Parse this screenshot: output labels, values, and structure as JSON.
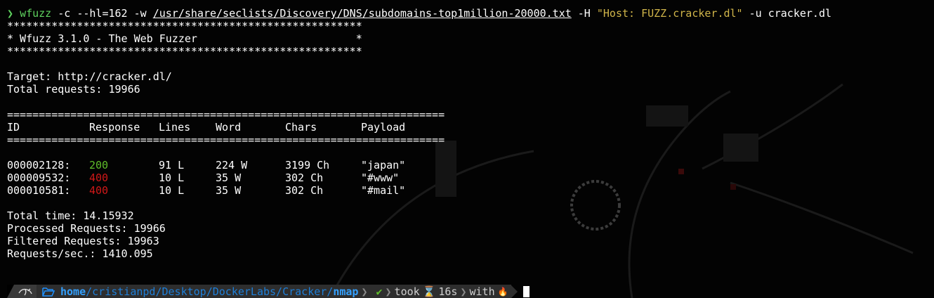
{
  "command": {
    "prompt_symbol": "❯",
    "program": "wfuzz",
    "args_before_path": " -c --hl=162 -w ",
    "wordlist_path": "/usr/share/seclists/Discovery/DNS/subdomains-top1million-20000.txt",
    "args_middle": " -H ",
    "header_string": "\"Host: FUZZ.cracker.dl\"",
    "args_after": " -u cracker.dl"
  },
  "banner": {
    "stars": "********************************************************",
    "title_line": "* Wfuzz 3.1.0 - The Web Fuzzer                         *"
  },
  "target": {
    "target_line": "Target: http://cracker.dl/",
    "total_requests_line": "Total requests: 19966"
  },
  "table": {
    "rule": "=====================================================================",
    "headers": {
      "id": "ID",
      "response": "Response",
      "lines": "Lines",
      "word": "Word",
      "chars": "Chars",
      "payload": "Payload"
    },
    "rows": [
      {
        "id": "000002128:",
        "response": "200",
        "lines": "91 L",
        "word": "224 W",
        "chars": "3199 Ch",
        "payload": "\"japan\""
      },
      {
        "id": "000009532:",
        "response": "400",
        "lines": "10 L",
        "word": "35 W",
        "chars": "302 Ch",
        "payload": "\"#www\""
      },
      {
        "id": "000010581:",
        "response": "400",
        "lines": "10 L",
        "word": "35 W",
        "chars": "302 Ch",
        "payload": "\"#mail\""
      }
    ]
  },
  "summary": {
    "total_time": "Total time: 14.15932",
    "processed": "Processed Requests: 19966",
    "filtered": "Filtered Requests: 19963",
    "rate": "Requests/sec.: 1410.095"
  },
  "prompt": {
    "os_icon": "kali-dragon-icon",
    "folder_icon": "folder-open-icon",
    "path_home": "home",
    "path_middle": "/cristianpd/Desktop/DockerLabs/Cracker/",
    "path_last": "nmap",
    "separator": "❯",
    "status_ok": "✔",
    "took_label": "took",
    "hourglass": "⌛",
    "duration": "16s",
    "with_label": "with",
    "fire": "🔥"
  },
  "colors": {
    "background": "#030303",
    "text": "#ffffff",
    "green": "#5fd35f",
    "string_yellow": "#d0b54a",
    "status_200": "#5fbf2a",
    "status_400": "#d01818",
    "path_blue": "#1e90ff"
  }
}
